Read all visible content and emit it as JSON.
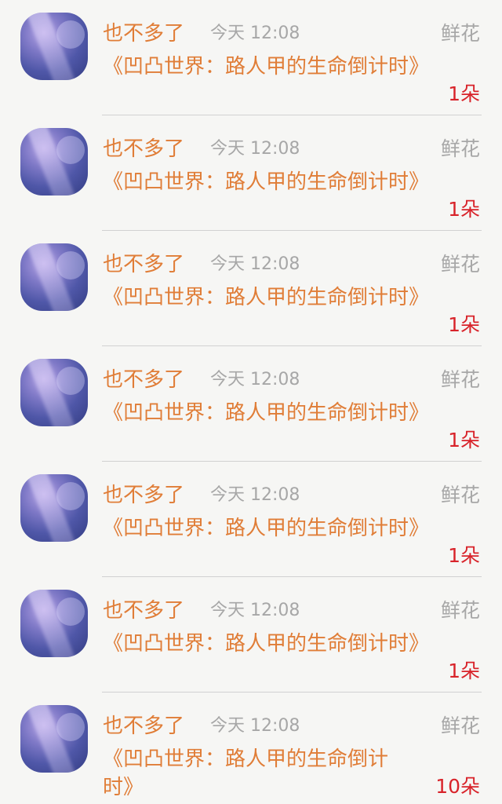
{
  "rows": [
    {
      "user": "也不多了",
      "time": "今天 12:08",
      "gift": "鲜花",
      "book": "《凹凸世界：路人甲的生命倒计时》",
      "count": "1朵"
    },
    {
      "user": "也不多了",
      "time": "今天 12:08",
      "gift": "鲜花",
      "book": "《凹凸世界：路人甲的生命倒计时》",
      "count": "1朵"
    },
    {
      "user": "也不多了",
      "time": "今天 12:08",
      "gift": "鲜花",
      "book": "《凹凸世界：路人甲的生命倒计时》",
      "count": "1朵"
    },
    {
      "user": "也不多了",
      "time": "今天 12:08",
      "gift": "鲜花",
      "book": "《凹凸世界：路人甲的生命倒计时》",
      "count": "1朵"
    },
    {
      "user": "也不多了",
      "time": "今天 12:08",
      "gift": "鲜花",
      "book": "《凹凸世界：路人甲的生命倒计时》",
      "count": "1朵"
    },
    {
      "user": "也不多了",
      "time": "今天 12:08",
      "gift": "鲜花",
      "book": "《凹凸世界：路人甲的生命倒计时》",
      "count": "1朵"
    },
    {
      "user": "也不多了",
      "time": "今天 12:08",
      "gift": "鲜花",
      "book": "《凹凸世界：路人甲的生命倒计时》",
      "count": "10朵"
    }
  ],
  "colors": {
    "username": "#e07d37",
    "meta": "#a7a7a7",
    "count": "#d8232a",
    "background": "#f6f6f4",
    "divider": "#d1d1d1"
  }
}
